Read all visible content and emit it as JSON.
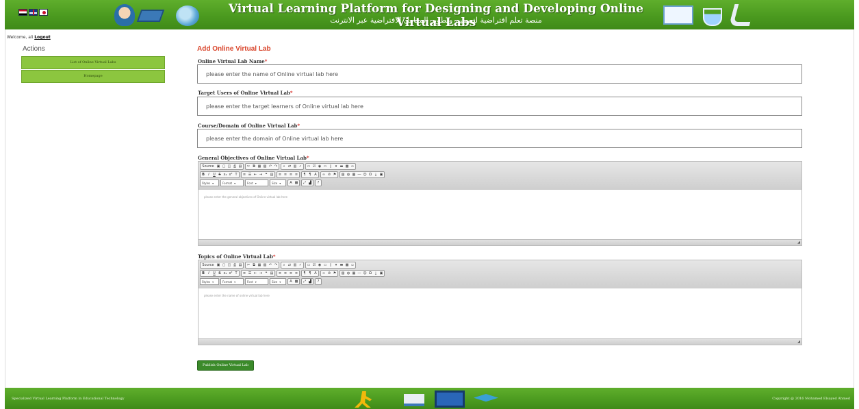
{
  "header": {
    "title_en": "Virtual Learning Platform for Designing and Developing Online Virtual Labs",
    "title_ar": "منصة تعلم افتراضية لتصميم وتطوير المعامل الافتراضية عبر الانترنت",
    "brand_color": "#4b9a1f"
  },
  "welcome": {
    "text": "Welcome, ali",
    "logout_label": "Logout"
  },
  "sidebar": {
    "title": "Actions",
    "items": [
      {
        "label": "List of Online Virtual Labs"
      },
      {
        "label": "Homepage"
      }
    ]
  },
  "form": {
    "heading": "Add Online Virtual Lab",
    "fields": [
      {
        "label": "Online Virtual Lab Name",
        "placeholder": "please enter the name of Online virtual lab here",
        "value": ""
      },
      {
        "label": "Target Users of Online Virtual Lab",
        "placeholder": "please enter the target learners of Online virtual lab here",
        "value": ""
      },
      {
        "label": "Course/Domain of Online Virtual Lab",
        "placeholder": "please enter the domain of Online virtual lab here",
        "value": ""
      }
    ],
    "editors": [
      {
        "label": "General Objectives of Online Virtual Lab",
        "placeholder": "please enter the general objectives of Online virtual lab here"
      },
      {
        "label": "Topics of Online Virtual Lab",
        "placeholder": "please enter the name of online virtual lab here"
      }
    ],
    "required_mark": "*",
    "toolbar": {
      "source_label": "Source",
      "styles_label": "Styles",
      "format_label": "Format",
      "font_label": "Font",
      "size_label": "Size"
    },
    "submit_label": "Publish Online Virtual Lab"
  },
  "footer": {
    "left_text": "Specialized Virtual Learning Platform in Educational Technology",
    "right_text": "Copyright @ 2016 Mohamed Elsayed Ahmed"
  }
}
